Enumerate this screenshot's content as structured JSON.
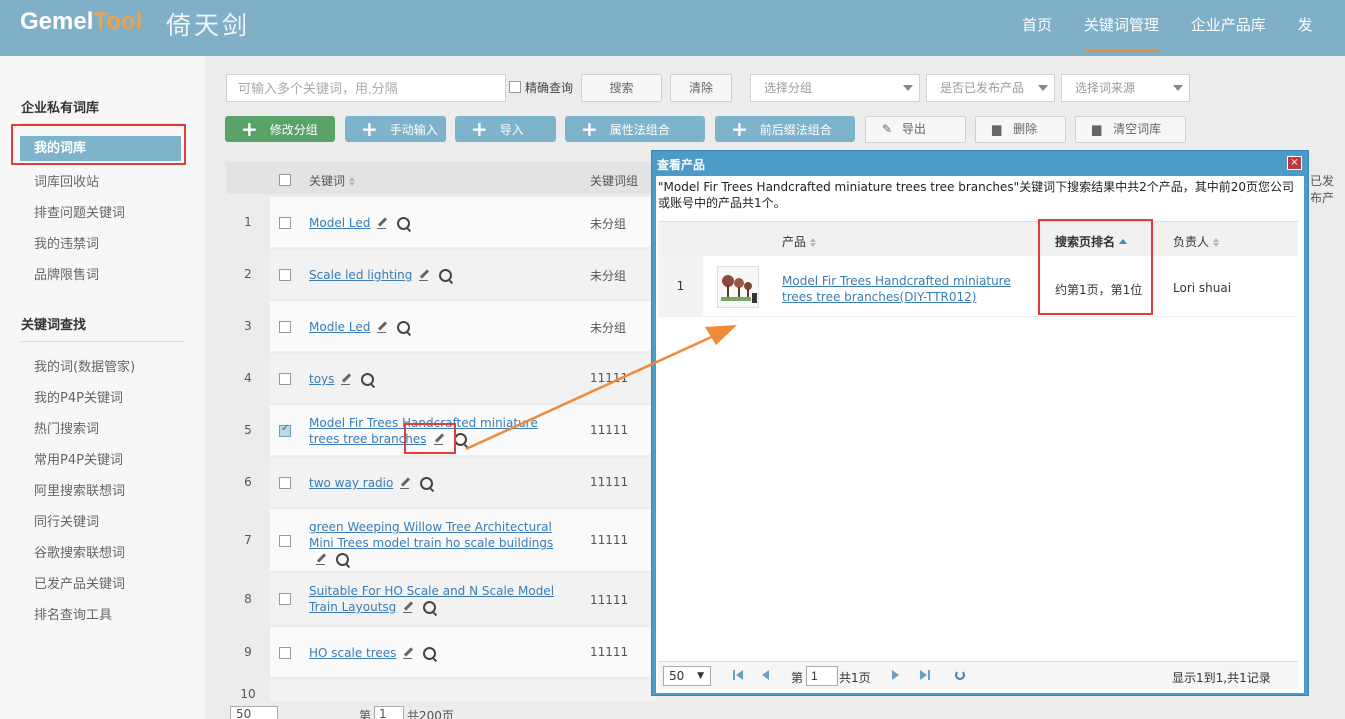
{
  "header": {
    "logo_part1": "Gemel",
    "logo_part2": "Tool",
    "logo_cn": "倚天剑",
    "nav": [
      "首页",
      "关键词管理",
      "企业产品库",
      "发"
    ],
    "accent": "#ee8a3c",
    "bar_color": "#7fb0c7"
  },
  "sidebar": {
    "section1_title": "企业私有词库",
    "section1_items": [
      "我的词库",
      "词库回收站",
      "排查问题关键词",
      "我的违禁词",
      "品牌限售词"
    ],
    "section2_title": "关键词查找",
    "section2_items": [
      "我的词(数据管家)",
      "我的P4P关键词",
      "热门搜索词",
      "常用P4P关键词",
      "阿里搜索联想词",
      "同行关键词",
      "谷歌搜索联想词",
      "已发产品关键词",
      "排名查询工具"
    ]
  },
  "toolbar": {
    "search_placeholder": "可输入多个关键词，用,分隔",
    "exact_label": "精确查询",
    "search_button": "搜索",
    "clear_button": "清除",
    "select_group": "选择分组",
    "select_published": "是否已发布产品",
    "select_source": "选择词来源",
    "btn_modify_group": "修改分组",
    "btn_manual_input": "手动输入",
    "btn_import": "导入",
    "btn_attr_combine": "属性法组合",
    "btn_affix_combine": "前后缀法组合",
    "btn_export": "导出",
    "btn_delete": "删除",
    "btn_clear_library": "清空词库"
  },
  "table": {
    "col_keyword": "关键词",
    "col_group": "关键词组",
    "col_published": "已发布产",
    "rows": [
      {
        "num": "1",
        "kw": "Model Led",
        "group": "未分组"
      },
      {
        "num": "2",
        "kw": "Scale led lighting",
        "group": "未分组"
      },
      {
        "num": "3",
        "kw": "Modle Led",
        "group": "未分组"
      },
      {
        "num": "4",
        "kw": "toys",
        "group": "11111"
      },
      {
        "num": "5",
        "kw": "Model Fir Trees Handcrafted miniature trees tree branches",
        "group": "11111"
      },
      {
        "num": "6",
        "kw": "two way radio",
        "group": "11111"
      },
      {
        "num": "7",
        "kw": "green Weeping Willow Tree Architectural Mini Trees model train ho scale buildings",
        "group": "11111"
      },
      {
        "num": "8",
        "kw": "Suitable For HO Scale and N Scale Model Train Layoutsg",
        "group": "11111"
      },
      {
        "num": "9",
        "kw": "HO scale trees",
        "group": "11111"
      },
      {
        "num": "10",
        "kw": "",
        "group": ""
      }
    ]
  },
  "main_pager": {
    "per_page": "50",
    "page_prefix": "第",
    "page": "1",
    "total_pages": "共200页"
  },
  "modal": {
    "title": "查看产品",
    "close": "×",
    "info": "\"Model Fir Trees Handcrafted miniature trees tree branches\"关键词下搜索结果中共2个产品，其中前20页您公司或账号中的产品共1个。",
    "col_product": "产品",
    "col_rank": "搜索页排名",
    "col_owner": "负责人",
    "row": {
      "num": "1",
      "product": "Model Fir Trees Handcrafted miniature trees tree branches(DIY-TTR012)",
      "rank": "约第1页，第1位",
      "owner": "Lori shuai"
    },
    "pager": {
      "per_page": "50",
      "page_prefix": "第",
      "page": "1",
      "total_pages": "共1页",
      "summary": "显示1到1,共1记录"
    }
  },
  "colors": {
    "annotation_red": "#e23b3b",
    "arrow": "#f08a3a",
    "modal_blue": "#4c9bc7",
    "link": "#3a7cb3"
  }
}
